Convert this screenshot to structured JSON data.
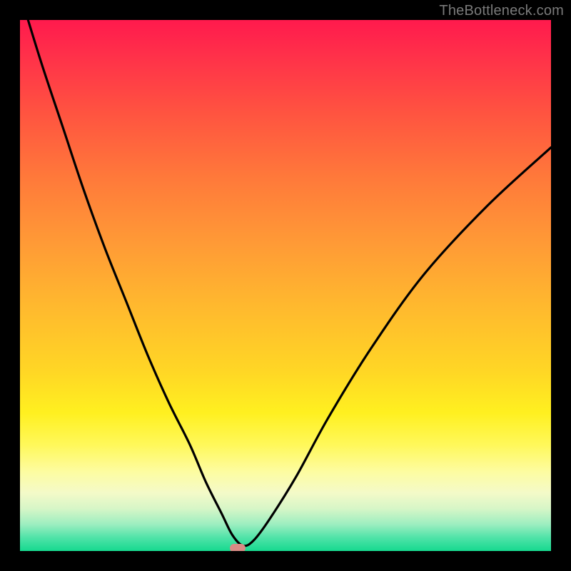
{
  "watermark": "TheBottleneck.com",
  "colors": {
    "frame": "#000000",
    "curve": "#000000",
    "marker": "#d98b85",
    "gradient_top": "#ff1a4d",
    "gradient_mid": "#ffd625",
    "gradient_bottom": "#16d98f"
  },
  "chart_data": {
    "type": "line",
    "title": "",
    "xlabel": "",
    "ylabel": "",
    "xlim": [
      0,
      100
    ],
    "ylim": [
      0,
      100
    ],
    "grid": false,
    "legend": false,
    "series": [
      {
        "name": "bottleneck-curve",
        "x": [
          0,
          4,
          8,
          12,
          16,
          20,
          24,
          28,
          32,
          35,
          38,
          40,
          42,
          44,
          47,
          52,
          58,
          66,
          76,
          88,
          100
        ],
        "y": [
          105,
          92,
          80,
          68,
          57,
          47,
          37,
          28,
          20,
          13,
          7,
          3,
          1,
          2,
          6,
          14,
          25,
          38,
          52,
          65,
          76
        ]
      }
    ],
    "annotations": [
      {
        "name": "optimum-marker",
        "x": 41,
        "y": 0.5
      }
    ]
  }
}
